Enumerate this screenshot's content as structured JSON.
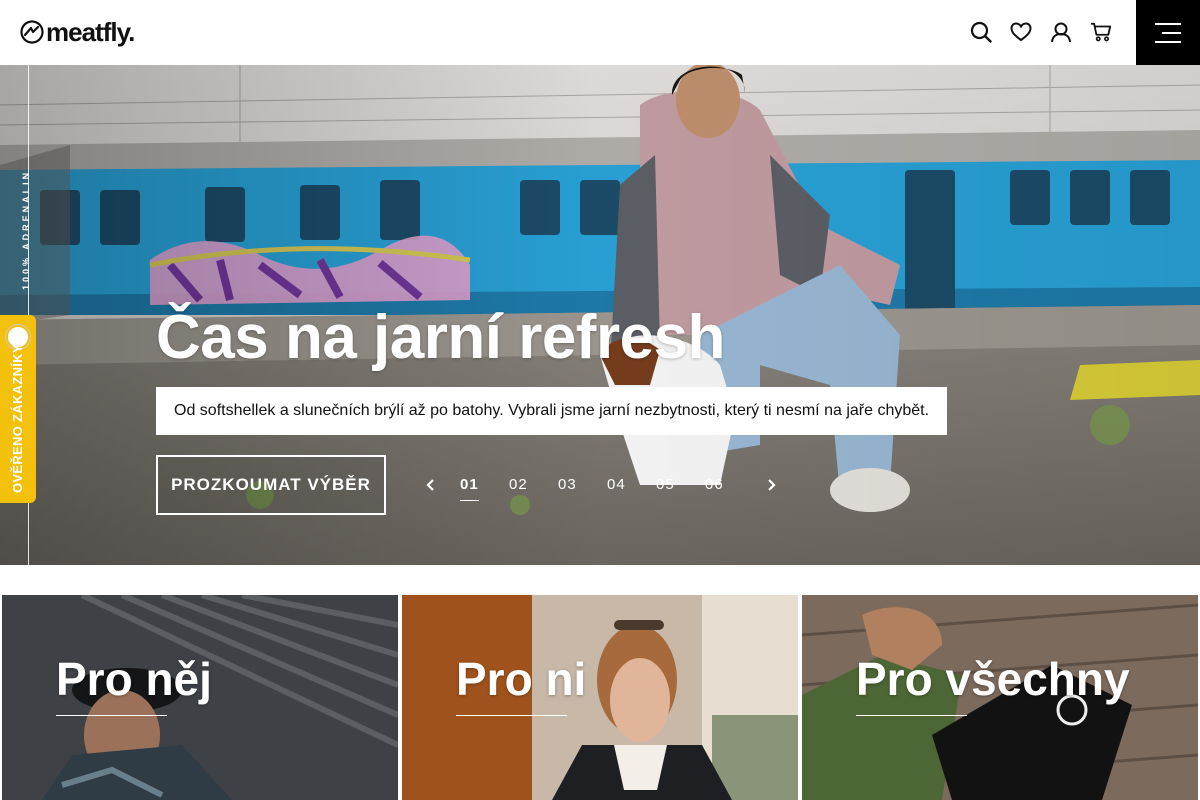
{
  "header": {
    "logo_text": "meatfly.",
    "icons": [
      "search-icon",
      "heart-icon",
      "user-icon",
      "cart-icon",
      "menu-icon"
    ]
  },
  "hero": {
    "side_text": "100% ADRENALIN",
    "badge_text": "OVĚŘENO ZÁKAZNÍKY",
    "title": "Čas na jarní refresh",
    "subtitle": "Od softshellek a slunečních brýlí až po batohy. Vybrali jsme jarní nezbytnosti, který ti nesmí na jaře chybět.",
    "cta_label": "PROZKOUMAT VÝBĚR",
    "slides": [
      "01",
      "02",
      "03",
      "04",
      "05",
      "06"
    ],
    "active_slide": "01"
  },
  "categories": [
    {
      "title": "Pro něj"
    },
    {
      "title": "Pro ni"
    },
    {
      "title": "Pro všechny"
    }
  ],
  "colors": {
    "badge": "#f3c10b",
    "menu_bg": "#000000",
    "train_blue": "#2aa7de"
  }
}
